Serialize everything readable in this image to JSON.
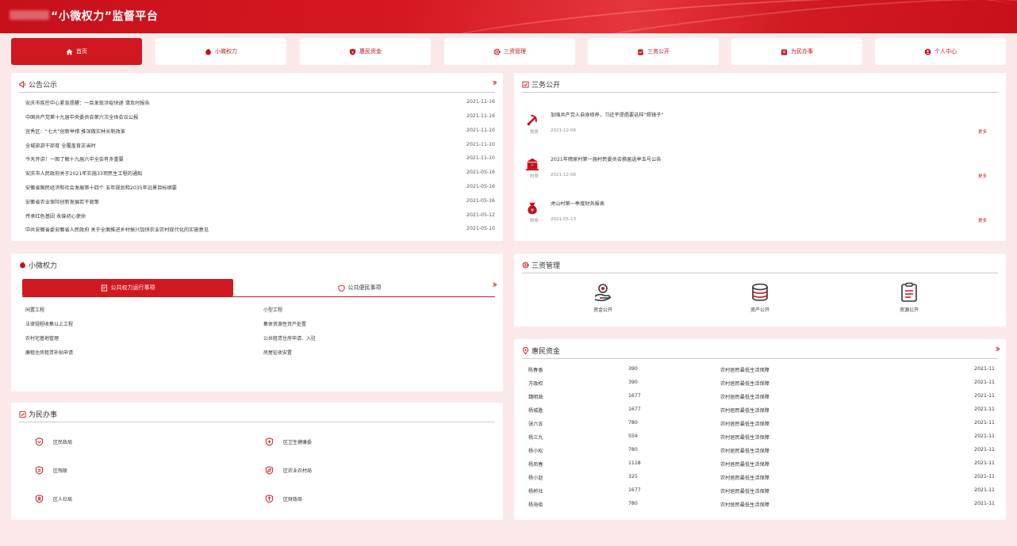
{
  "header": {
    "title": "“小微权力”监督平台"
  },
  "nav": [
    {
      "label": "首页",
      "icon": "home-icon",
      "active": true
    },
    {
      "label": "小微权力",
      "icon": "power-icon"
    },
    {
      "label": "惠民资金",
      "icon": "shield-icon"
    },
    {
      "label": "三资管理",
      "icon": "gear-icon"
    },
    {
      "label": "三务公开",
      "icon": "clipboard-icon"
    },
    {
      "label": "为民办事",
      "icon": "checklist-icon"
    },
    {
      "label": "个人中心",
      "icon": "user-icon"
    }
  ],
  "announcements": {
    "title": "公告公示",
    "more": "››",
    "items": [
      {
        "text": "安庆市疾控中心紧急提醒：一旦发现涉疫快递 请及时报告",
        "date": "2021-11-16"
      },
      {
        "text": "中国共产党第十九届中央委员会第六次全体会议公报",
        "date": "2021-11-16"
      },
      {
        "text": "宜秀区：“七大”创新举措 推深做实林长制改革",
        "date": "2021-11-10"
      },
      {
        "text": "全域旅游干部育 全覆盖育正当时",
        "date": "2021-11-10"
      },
      {
        "text": "今天开讲！一图了解十九届六中全会有多重要",
        "date": "2021-11-10"
      },
      {
        "text": "安庆市人民政府关于2021年实施33项民生工程的通知",
        "date": "2021-05-16"
      },
      {
        "text": "安徽省国民经济和社会发展第十四个 五年规划和2035年远景目标纲要",
        "date": "2021-05-16"
      },
      {
        "text": "安徽省农业保险创新发展若干政策",
        "date": "2021-05-16"
      },
      {
        "text": "传承红色基因 永葆初心使命",
        "date": "2021-05-12"
      },
      {
        "text": "中共安徽省委安徽省人民政府 关于全面推进乡村振兴加快农业农村现代化的实施意见",
        "date": "2021-05-10"
      }
    ]
  },
  "three_affairs": {
    "title": "三务公开",
    "items": [
      {
        "title": "加强共产党人自身修养，习近平提倡要这样“照镜子”",
        "type": "党务",
        "date": "2021-12-06",
        "more": "更多",
        "icon": "party-emblem-icon"
      },
      {
        "title": "2021年隋家村第一届村民委员会换届选举五号公告",
        "type": "村务",
        "date": "2021-12-06",
        "more": "更多",
        "icon": "village-building-icon"
      },
      {
        "title": "虎山村第一季度财务报表",
        "type": "财务",
        "date": "2021-05-13",
        "more": "更多",
        "icon": "money-bag-icon"
      }
    ]
  },
  "micro_power": {
    "title": "小微权力",
    "more": "››",
    "tabs": [
      {
        "label": "公共权力运行事项",
        "active": true
      },
      {
        "label": "公共便民事项"
      }
    ],
    "left": [
      "闲置工程",
      "法律规程收集以上工程",
      "农村宅基地管理",
      "廉租住房租赁补贴申请"
    ],
    "right": [
      "小型工程",
      "集体资源性资产处置",
      "公共租赁住房申请、入驻",
      "房屋征收安置"
    ]
  },
  "assets": {
    "title": "三资管理",
    "items": [
      {
        "label": "资金公开",
        "icon": "hand-money-icon"
      },
      {
        "label": "资产公开",
        "icon": "coin-stack-icon"
      },
      {
        "label": "资源公开",
        "icon": "clipboard-list-icon"
      }
    ]
  },
  "benefit_funds": {
    "title": "惠民资金",
    "more": "››",
    "rows": [
      {
        "name": "陈春香",
        "amount": "390",
        "type": "农村居民最低生活保障",
        "date": "2021-11"
      },
      {
        "name": "方政权",
        "amount": "390",
        "type": "农村居民最低生活保障",
        "date": "2021-11"
      },
      {
        "name": "魏明政",
        "amount": "1677",
        "type": "农村居民最低生活保障",
        "date": "2021-11"
      },
      {
        "name": "杨城胜",
        "amount": "1677",
        "type": "农村居民最低生活保障",
        "date": "2021-11"
      },
      {
        "name": "张六五",
        "amount": "780",
        "type": "农村居民最低生活保障",
        "date": "2021-11"
      },
      {
        "name": "杨三九",
        "amount": "559",
        "type": "农村居民最低生活保障",
        "date": "2021-11"
      },
      {
        "name": "杨小松",
        "amount": "780",
        "type": "农村居民最低生活保障",
        "date": "2021-11"
      },
      {
        "name": "杨凤春",
        "amount": "1118",
        "type": "农村居民最低生活保障",
        "date": "2021-11"
      },
      {
        "name": "杨小赵",
        "amount": "325",
        "type": "农村居民最低生活保障",
        "date": "2021-11"
      },
      {
        "name": "杨桥社",
        "amount": "1677",
        "type": "农村居民最低生活保障",
        "date": "2021-11"
      },
      {
        "name": "杨海俊",
        "amount": "780",
        "type": "农村居民最低生活保障",
        "date": "2021-11"
      }
    ]
  },
  "for_people": {
    "title": "为民办事",
    "items": [
      {
        "label": "区民政局",
        "icon": "heart-shield-icon"
      },
      {
        "label": "区卫生健康委",
        "icon": "medical-shield-icon"
      },
      {
        "label": "区残联",
        "icon": "hands-shield-icon"
      },
      {
        "label": "区农业农村局",
        "icon": "leaf-shield-icon"
      },
      {
        "label": "区人社局",
        "icon": "people-shield-icon"
      },
      {
        "label": "区财政局",
        "icon": "finance-shield-icon"
      }
    ]
  }
}
